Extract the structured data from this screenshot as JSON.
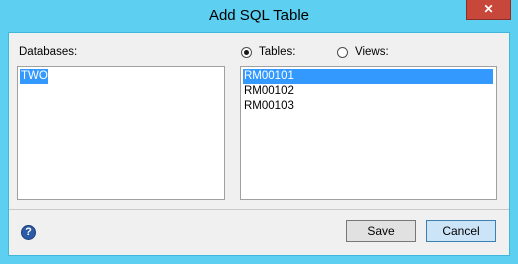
{
  "window": {
    "title": "Add SQL Table",
    "close_icon": "close-x-icon",
    "accent_color": "#5dcff0"
  },
  "databases": {
    "label": "Databases:",
    "items": [
      "TWO"
    ],
    "selected_index": 0
  },
  "source": {
    "tables_label": "Tables:",
    "views_label": "Views:",
    "selected": "Tables"
  },
  "tables": {
    "items": [
      "RM00101",
      "RM00102",
      "RM00103"
    ],
    "selected_index": 0
  },
  "footer": {
    "help_icon": "help-question-icon",
    "save_label": "Save",
    "cancel_label": "Cancel"
  }
}
